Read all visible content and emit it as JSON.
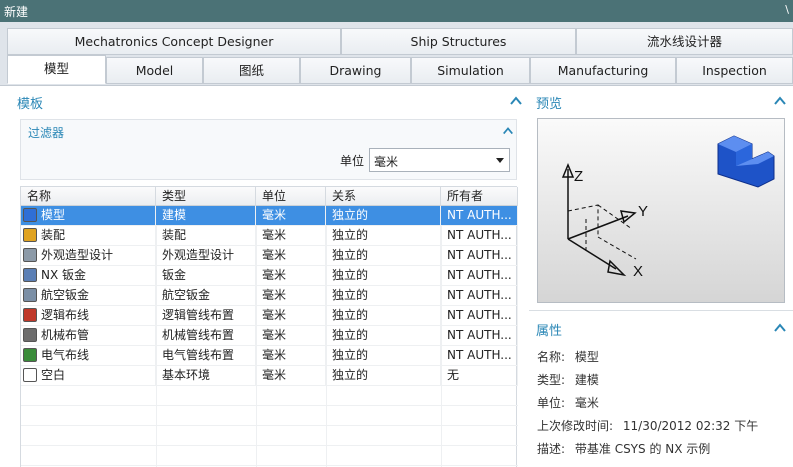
{
  "window": {
    "title": "新建",
    "control": "\\"
  },
  "tabs_row1": [
    "Mechatronics Concept Designer",
    "Ship Structures",
    "流水线设计器"
  ],
  "tabs_row2": [
    "模型",
    "Model",
    "图纸",
    "Drawing",
    "Simulation",
    "Manufacturing",
    "Inspection"
  ],
  "active_tab": "模型",
  "templates": {
    "title": "模板",
    "filter": {
      "title": "过滤器",
      "unit_label": "单位",
      "unit_value": "毫米"
    },
    "columns": [
      "名称",
      "类型",
      "单位",
      "关系",
      "所有者"
    ],
    "rows": [
      {
        "name": "模型",
        "type": "建模",
        "unit": "毫米",
        "relation": "独立的",
        "owner": "NT AUTH...",
        "icon": "model-icon",
        "selected": true
      },
      {
        "name": "装配",
        "type": "装配",
        "unit": "毫米",
        "relation": "独立的",
        "owner": "NT AUTH...",
        "icon": "assembly-icon"
      },
      {
        "name": "外观造型设计",
        "type": "外观造型设计",
        "unit": "毫米",
        "relation": "独立的",
        "owner": "NT AUTH...",
        "icon": "shape-studio-icon"
      },
      {
        "name": "NX 钣金",
        "type": "钣金",
        "unit": "毫米",
        "relation": "独立的",
        "owner": "NT AUTH...",
        "icon": "sheet-metal-icon"
      },
      {
        "name": "航空钣金",
        "type": "航空钣金",
        "unit": "毫米",
        "relation": "独立的",
        "owner": "NT AUTH...",
        "icon": "aero-sheet-metal-icon"
      },
      {
        "name": "逻辑布线",
        "type": "逻辑管线布置",
        "unit": "毫米",
        "relation": "独立的",
        "owner": "NT AUTH...",
        "icon": "logical-routing-icon"
      },
      {
        "name": "机械布管",
        "type": "机械管线布置",
        "unit": "毫米",
        "relation": "独立的",
        "owner": "NT AUTH...",
        "icon": "mechanical-routing-icon"
      },
      {
        "name": "电气布线",
        "type": "电气管线布置",
        "unit": "毫米",
        "relation": "独立的",
        "owner": "NT AUTH...",
        "icon": "electrical-routing-icon"
      },
      {
        "name": "空白",
        "type": "基本环境",
        "unit": "毫米",
        "relation": "独立的",
        "owner": "无",
        "icon": "blank-file-icon"
      }
    ]
  },
  "preview": {
    "title": "预览",
    "axes": [
      "Z",
      "Y",
      "X"
    ]
  },
  "properties": {
    "title": "属性",
    "items": [
      {
        "label": "名称:",
        "value": "模型"
      },
      {
        "label": "类型:",
        "value": "建模"
      },
      {
        "label": "单位:",
        "value": "毫米"
      },
      {
        "label": "上次修改时间:",
        "value": "11/30/2012 02:32 下午"
      },
      {
        "label": "描述:",
        "value": "带基准 CSYS 的 NX 示例"
      }
    ]
  },
  "colors": {
    "accent": "#2a87b6",
    "selection": "#3e8fe3",
    "titlebar": "#4b7276"
  }
}
